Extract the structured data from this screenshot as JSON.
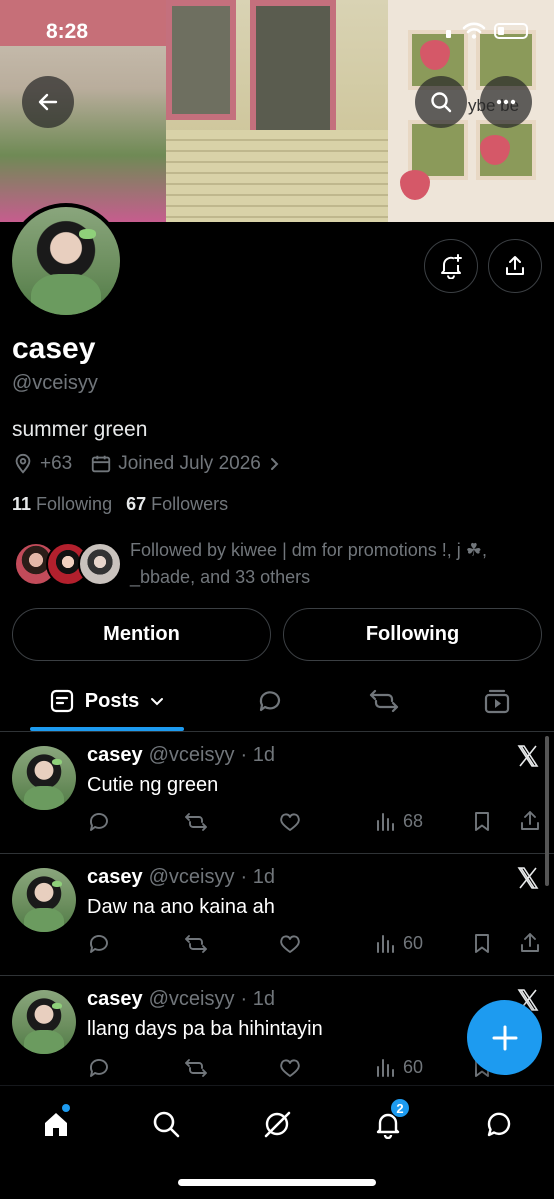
{
  "status_bar": {
    "time": "8:28"
  },
  "banner": {
    "overlay_text": "ybe be"
  },
  "profile": {
    "name": "casey",
    "handle": "@vceisyy",
    "bio": "summer green",
    "location": "+63",
    "joined": "Joined July 2026",
    "following_count": "11",
    "following_label": "Following",
    "followers_count": "67",
    "followers_label": "Followers",
    "followed_by": "Followed by kiwee | dm for promotions !, j ☘︎, _bbade, and 33 others"
  },
  "buttons": {
    "mention": "Mention",
    "following": "Following"
  },
  "tabs": {
    "posts": "Posts"
  },
  "posts": [
    {
      "name": "casey",
      "handle": "@vceisyy",
      "time": "· 1d",
      "text": "Cutie ng green",
      "views": "68"
    },
    {
      "name": "casey",
      "handle": "@vceisyy",
      "time": "· 1d",
      "text": "Daw na ano kaina ah",
      "views": "60"
    },
    {
      "name": "casey",
      "handle": "@vceisyy",
      "time": "· 1d",
      "text": "llang days pa ba hihintayin",
      "views": "60"
    }
  ],
  "nav": {
    "notifications_badge": "2"
  },
  "colors": {
    "accent": "#1d9bf0",
    "muted": "#71767b",
    "border": "#2f3336"
  }
}
